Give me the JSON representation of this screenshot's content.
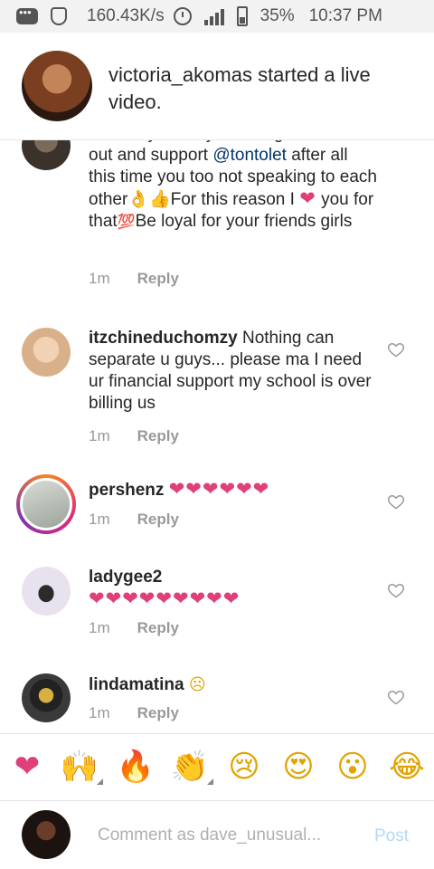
{
  "status_bar": {
    "speed": "160.43K/s",
    "battery": "35%",
    "time": "10:37 PM"
  },
  "live_header": {
    "text": "victoria_akomas started a live video."
  },
  "comments": [
    {
      "user": "",
      "text_before": "definitely knew you was gonna come out and support ",
      "mention": "@tontolet",
      "text_after": " after all this time you too not speaking to each other",
      "text_for": "For this reason I ",
      "text_end": " you for that",
      "text_final": "Be loyal for your friends girls",
      "time": "1m",
      "reply": "Reply"
    },
    {
      "user": "itzchineduchomzy",
      "text": "Nothing can separate u guys... please ma I need ur financial support my school is over billing us",
      "time": "1m",
      "reply": "Reply"
    },
    {
      "user": "pershenz",
      "hearts": "❤❤❤❤❤❤",
      "time": "1m",
      "reply": "Reply"
    },
    {
      "user": "ladygee2",
      "hearts": "❤❤❤❤❤❤❤❤❤",
      "time": "1m",
      "reply": "Reply"
    },
    {
      "user": "lindamatina",
      "emoji": "☹",
      "time": "1m",
      "reply": "Reply"
    }
  ],
  "emoji_bar": [
    "❤",
    "🙌",
    "🔥",
    "👏",
    "😢",
    "😍",
    "😮",
    "😂"
  ],
  "compose": {
    "placeholder": "Comment as dave_unusual...",
    "post_label": "Post"
  },
  "colors": {
    "accent_link": "#003569",
    "heart_pink": "#e0407a",
    "post_disabled": "#b3d9f5",
    "meta_gray": "#999999"
  }
}
